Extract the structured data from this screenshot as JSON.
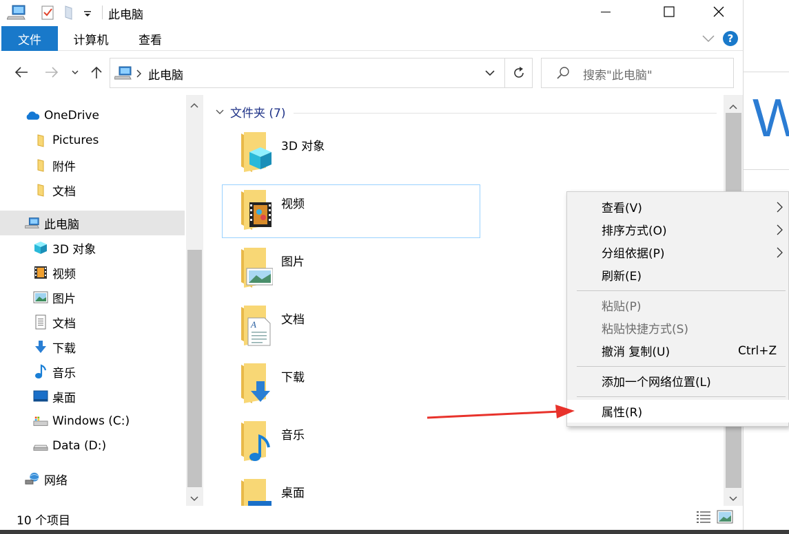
{
  "window": {
    "title": "此电脑"
  },
  "ribbon": {
    "tabs": [
      {
        "label": "文件"
      },
      {
        "label": "计算机"
      },
      {
        "label": "查看"
      }
    ],
    "help_label": "?"
  },
  "address_bar": {
    "path": "此电脑"
  },
  "search": {
    "placeholder": "搜索\"此电脑\""
  },
  "nav_pane": {
    "items": [
      {
        "label": "OneDrive",
        "icon": "onedrive-cloud-icon"
      },
      {
        "label": "Pictures",
        "icon": "folder-icon"
      },
      {
        "label": "附件",
        "icon": "folder-icon"
      },
      {
        "label": "文档",
        "icon": "folder-icon"
      },
      {
        "label": "此电脑",
        "icon": "this-pc-icon"
      },
      {
        "label": "3D 对象",
        "icon": "3d-objects-icon"
      },
      {
        "label": "视频",
        "icon": "videos-icon"
      },
      {
        "label": "图片",
        "icon": "pictures-icon"
      },
      {
        "label": "文档",
        "icon": "documents-icon"
      },
      {
        "label": "下载",
        "icon": "downloads-icon"
      },
      {
        "label": "音乐",
        "icon": "music-icon"
      },
      {
        "label": "桌面",
        "icon": "desktop-icon"
      },
      {
        "label": "Windows (C:)",
        "icon": "system-drive-icon"
      },
      {
        "label": "Data (D:)",
        "icon": "drive-icon"
      },
      {
        "label": "网络",
        "icon": "network-icon"
      }
    ]
  },
  "content": {
    "group_header": "文件夹 (7)",
    "folders": [
      {
        "label": "3D 对象",
        "overlay": "3d-cube-icon"
      },
      {
        "label": "视频",
        "overlay": "film-icon"
      },
      {
        "label": "图片",
        "overlay": "landscape-icon"
      },
      {
        "label": "文档",
        "overlay": "document-icon"
      },
      {
        "label": "下载",
        "overlay": "down-arrow-icon"
      },
      {
        "label": "音乐",
        "overlay": "music-note-icon"
      },
      {
        "label": "桌面",
        "overlay": "desktop-icon"
      }
    ]
  },
  "status_bar": {
    "item_count": "10 个项目"
  },
  "context_menu": {
    "items": [
      {
        "label": "查看(V)",
        "submenu": true
      },
      {
        "label": "排序方式(O)",
        "submenu": true
      },
      {
        "label": "分组依据(P)",
        "submenu": true
      },
      {
        "label": "刷新(E)"
      },
      {
        "label": "粘贴(P)",
        "disabled": true
      },
      {
        "label": "粘贴快捷方式(S)",
        "disabled": true
      },
      {
        "label": "撤消 复制(U)",
        "shortcut": "Ctrl+Z"
      },
      {
        "label": "添加一个网络位置(L)"
      },
      {
        "label": "属性(R)"
      }
    ]
  },
  "background_window": {
    "letter": "W"
  },
  "colors": {
    "accent": "#1979ca",
    "folder_yellow": "#f8d775",
    "selection_border": "#99d1ff",
    "annotation_arrow": "#e8322b"
  }
}
